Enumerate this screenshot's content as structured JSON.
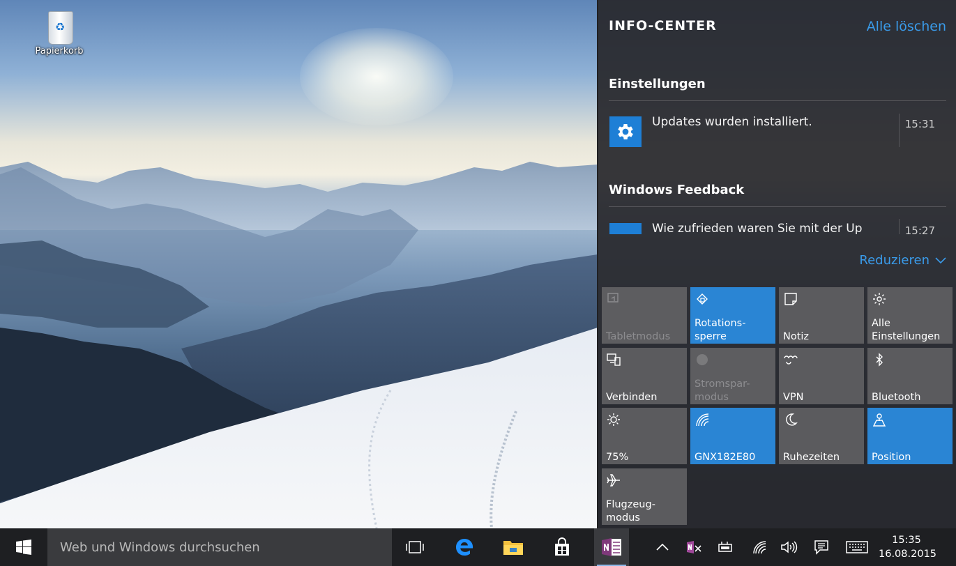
{
  "desktop": {
    "recycle_bin_label": "Papierkorb"
  },
  "action_center": {
    "title": "INFO-CENTER",
    "clear_all": "Alle löschen",
    "groups": [
      {
        "title": "Einstellungen",
        "notification": {
          "text": "Updates wurden installiert.",
          "time": "15:31",
          "icon": "gear-icon"
        }
      },
      {
        "title": "Windows Feedback",
        "notification": {
          "text": "Wie zufrieden waren Sie mit der Up",
          "time": "15:27",
          "icon": "feedback-icon"
        }
      }
    ],
    "collapse_label": "Reduzieren",
    "quick_actions": [
      {
        "label": "Tabletmodus",
        "icon": "tablet-mode-icon",
        "state": "disabled"
      },
      {
        "label": "Rotations-\nsperre",
        "icon": "rotation-lock-icon",
        "state": "on"
      },
      {
        "label": "Notiz",
        "icon": "note-icon",
        "state": "off"
      },
      {
        "label": "Alle\nEinstellungen",
        "icon": "settings-icon",
        "state": "off"
      },
      {
        "label": "Verbinden",
        "icon": "connect-icon",
        "state": "off"
      },
      {
        "label": "Stromspar-\nmodus",
        "icon": "battery-saver-icon",
        "state": "disabled"
      },
      {
        "label": "VPN",
        "icon": "vpn-icon",
        "state": "off"
      },
      {
        "label": "Bluetooth",
        "icon": "bluetooth-icon",
        "state": "off"
      },
      {
        "label": "75%",
        "icon": "brightness-icon",
        "state": "off"
      },
      {
        "label": "GNX182E80",
        "icon": "wifi-icon",
        "state": "on"
      },
      {
        "label": "Ruhezeiten",
        "icon": "quiet-hours-icon",
        "state": "off"
      },
      {
        "label": "Position",
        "icon": "location-icon",
        "state": "on"
      },
      {
        "label": "Flugzeug-\nmodus",
        "icon": "airplane-icon",
        "state": "off"
      }
    ]
  },
  "taskbar": {
    "search_placeholder": "Web und Windows durchsuchen",
    "pinned": [
      "task-view-icon",
      "edge-icon",
      "file-explorer-icon",
      "store-icon",
      "onenote-icon"
    ],
    "tray": [
      "show-hidden-icons-icon",
      "onenote-tray-icon",
      "power-icon",
      "wifi-icon",
      "volume-icon",
      "notifications-icon",
      "keyboard-icon"
    ],
    "time": "15:35",
    "date": "16.08.2015"
  },
  "colors": {
    "accent": "#2a85d4",
    "link": "#3a9bea",
    "taskbar": "#1e1f22"
  }
}
